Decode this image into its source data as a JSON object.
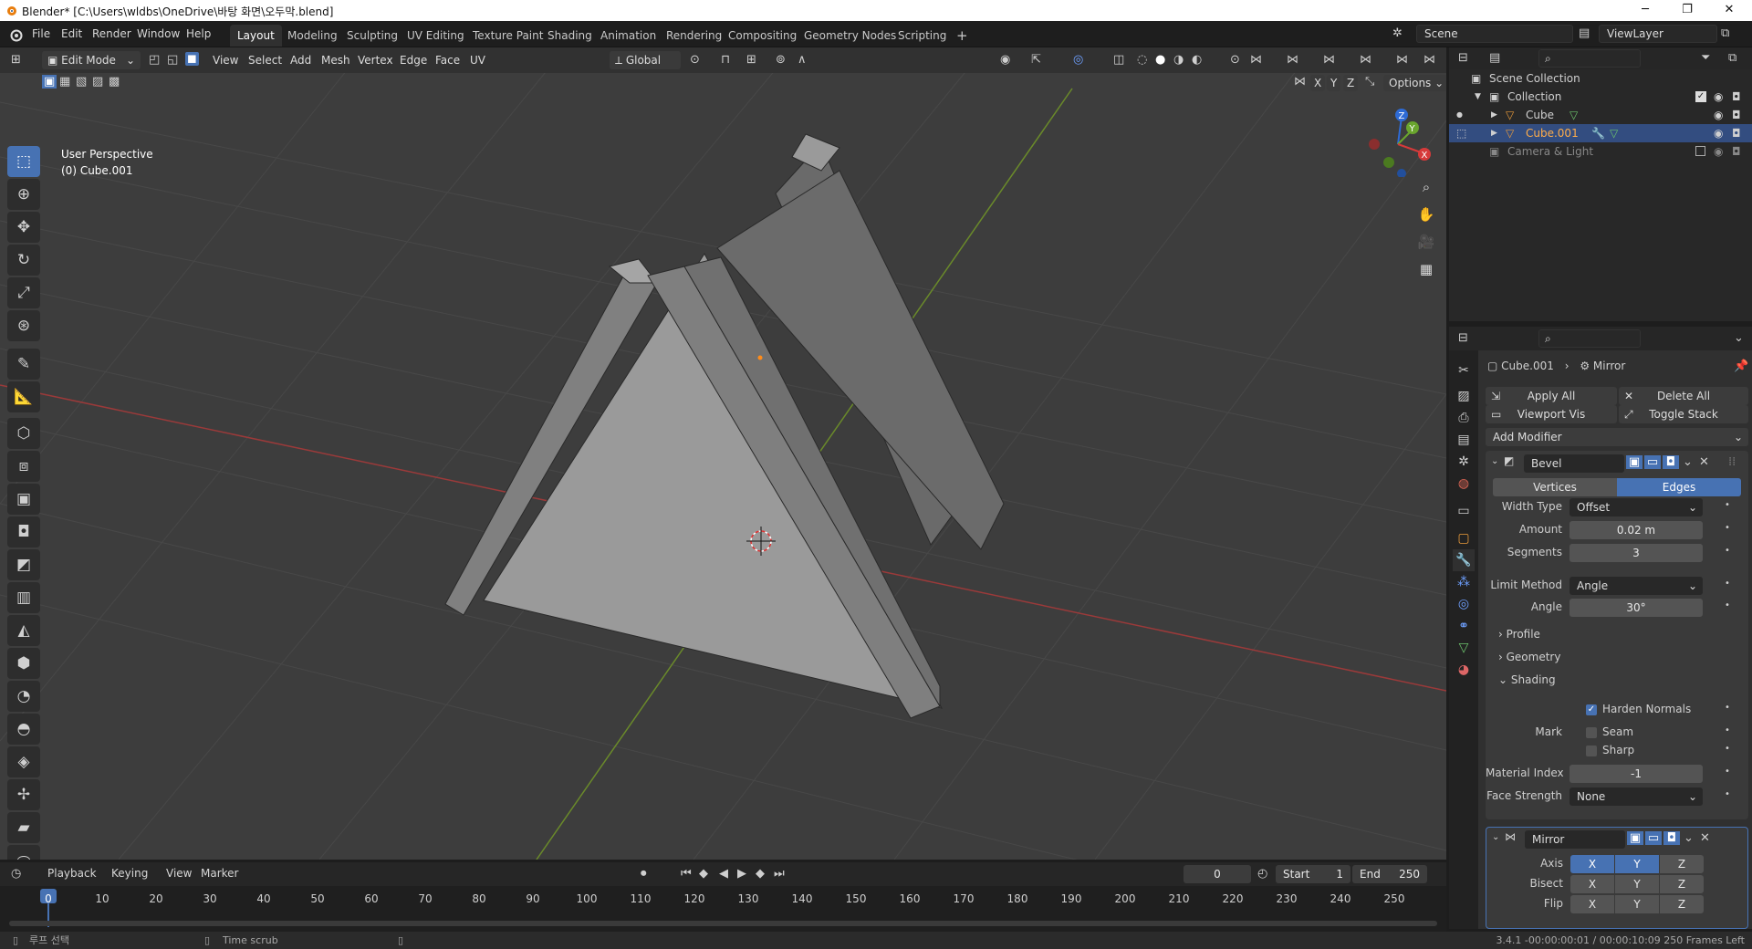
{
  "title": "Blender* [C:\\Users\\wldbs\\OneDrive\\바탕 화면\\오두막.blend]",
  "window_controls": {
    "minimize": "─",
    "maximize": "❐",
    "close": "✕"
  },
  "menus": [
    "File",
    "Edit",
    "Render",
    "Window",
    "Help"
  ],
  "workspaces": [
    "Layout",
    "Modeling",
    "Sculpting",
    "UV Editing",
    "Texture Paint",
    "Shading",
    "Animation",
    "Rendering",
    "Compositing",
    "Geometry Nodes",
    "Scripting"
  ],
  "add_workspace": "+",
  "scene": "Scene",
  "view_layer": "ViewLayer",
  "viewport": {
    "mode": "Edit Mode",
    "menus": [
      "View",
      "Select",
      "Add",
      "Mesh",
      "Vertex",
      "Edge",
      "Face",
      "UV"
    ],
    "orientation": "Global",
    "axis_toggles": [
      "X",
      "Y",
      "Z"
    ],
    "options": "Options",
    "info_line1": "User Perspective",
    "info_line2": "(0) Cube.001",
    "gizmo": {
      "z": "Z",
      "y": "Y",
      "x": "X"
    }
  },
  "outliner": {
    "search_placeholder": "",
    "root": "Scene Collection",
    "collection": "Collection",
    "items": [
      "Cube",
      "Cube.001",
      "Camera & Light"
    ]
  },
  "properties": {
    "breadcrumb_object": "Cube.001",
    "breadcrumb_sep": "›",
    "breadcrumb_modifier": "Mirror",
    "apply_all": "Apply All",
    "delete_all": "Delete All",
    "viewport_vis": "Viewport Vis",
    "toggle_stack": "Toggle Stack",
    "add_modifier": "Add Modifier",
    "bevel": {
      "name": "Bevel",
      "tab_vertices": "Vertices",
      "tab_edges": "Edges",
      "width_type_label": "Width Type",
      "width_type": "Offset",
      "amount_label": "Amount",
      "amount": "0.02 m",
      "segments_label": "Segments",
      "segments": "3",
      "limit_method_label": "Limit Method",
      "limit_method": "Angle",
      "angle_label": "Angle",
      "angle": "30°",
      "profile": "Profile",
      "geometry": "Geometry",
      "shading": "Shading",
      "harden_normals": "Harden Normals",
      "mark_label": "Mark",
      "seam": "Seam",
      "sharp": "Sharp",
      "material_index_label": "Material Index",
      "material_index": "-1",
      "face_strength_label": "Face Strength",
      "face_strength": "None"
    },
    "mirror": {
      "name": "Mirror",
      "axis_label": "Axis",
      "bisect_label": "Bisect",
      "flip_label": "Flip",
      "x": "X",
      "y": "Y",
      "z": "Z"
    }
  },
  "timeline": {
    "menus": [
      "Playback",
      "Keying",
      "View",
      "Marker"
    ],
    "current_frame": "0",
    "start_label": "Start",
    "start": "1",
    "end_label": "End",
    "end": "250",
    "ticks": [
      "0",
      "10",
      "20",
      "30",
      "40",
      "50",
      "60",
      "70",
      "80",
      "90",
      "100",
      "110",
      "120",
      "130",
      "140",
      "150",
      "160",
      "170",
      "180",
      "190",
      "200",
      "210",
      "220",
      "230",
      "240",
      "250"
    ]
  },
  "status": {
    "left": "루프 선택",
    "middle": "Time scrub",
    "right": "3.4.1  -00:00:00:01 / 00:00:10:09  250 Frames Left"
  }
}
